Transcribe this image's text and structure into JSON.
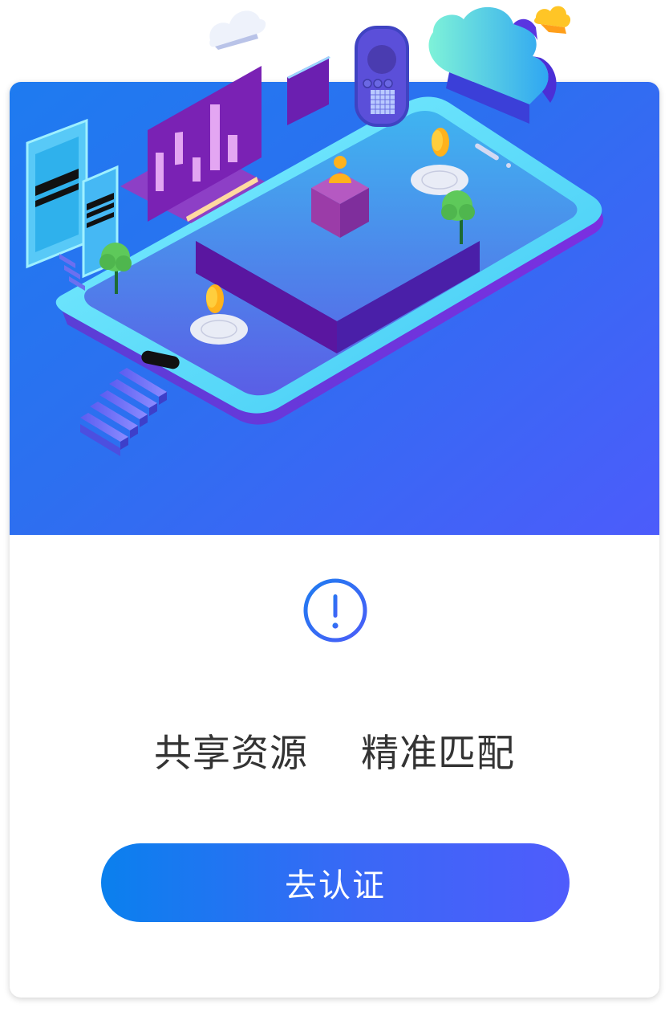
{
  "hero": {
    "illustration_icon": "isometric-smartphone-illustration",
    "background_gradient": [
      "#1e7bf0",
      "#4c5cfb"
    ]
  },
  "notice": {
    "icon": "exclamation-circle-icon",
    "icon_color": "#2f6ef2"
  },
  "tagline": {
    "left": "共享资源",
    "right": "精准匹配"
  },
  "action": {
    "label": "去认证",
    "gradient": [
      "#0a80ee",
      "#4f5cfc"
    ]
  }
}
